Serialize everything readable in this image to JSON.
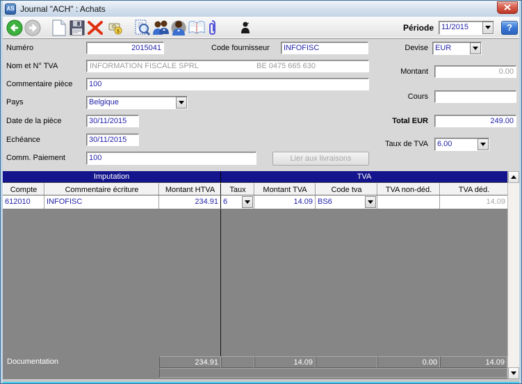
{
  "window": {
    "title": "Journal \"ACH\" : Achats",
    "app_icon_text": "AS"
  },
  "toolbar": {
    "icons": [
      "back-icon",
      "forward-icon",
      "new-document-icon",
      "save-icon",
      "delete-icon",
      "payment-icon",
      "preview-icon",
      "suppliers-icon",
      "supplier-icon",
      "book-icon",
      "attachment-icon",
      "user-icon"
    ],
    "period_label": "Période",
    "period_value": "11/2015",
    "help_label": "?"
  },
  "form": {
    "numero": {
      "label": "Numéro",
      "value": "2015041"
    },
    "code_fournisseur": {
      "label": "Code fournisseur",
      "value": "INFOFISC"
    },
    "nom_tva": {
      "label": "Nom et N° TVA",
      "name": "INFORMATION FISCALE SPRL",
      "vat": "BE 0475 665 630"
    },
    "commentaire_piece": {
      "label": "Commentaire pièce",
      "value": "100"
    },
    "pays": {
      "label": "Pays",
      "value": "Belgique"
    },
    "date_piece": {
      "label": "Date de la pièce",
      "value": "30/11/2015"
    },
    "echeance": {
      "label": "Echéance",
      "value": "30/11/2015"
    },
    "comm_paiement": {
      "label": "Comm. Paiement",
      "value": "100"
    },
    "lier_button_label": "Lier aux livraisons",
    "devise": {
      "label": "Devise",
      "value": "EUR"
    },
    "montant": {
      "label": "Montant",
      "value": "0.00"
    },
    "cours": {
      "label": "Cours",
      "value": ""
    },
    "total_eur": {
      "label": "Total EUR",
      "value": "249.00"
    },
    "taux_tva": {
      "label": "Taux de TVA",
      "value": "6.00"
    }
  },
  "table": {
    "groups": {
      "imputation": "Imputation",
      "tva": "TVA"
    },
    "columns": [
      "Compte",
      "Commentaire écriture",
      "Montant HTVA",
      "Taux",
      "Montant TVA",
      "Code tva",
      "TVA non-déd.",
      "TVA déd."
    ],
    "rows": [
      {
        "compte": "612010",
        "commentaire": "INFOFISC",
        "montant_htva": "234.91",
        "taux": "6",
        "montant_tva": "14.09",
        "code_tva": "BS6",
        "tva_non_ded": "",
        "tva_ded": "14.09"
      }
    ],
    "footer": {
      "label": "Documentation",
      "montant_htva": "234.91",
      "montant_tva": "14.09",
      "tva_non_ded": "0.00",
      "tva_ded": "14.09"
    }
  },
  "colors": {
    "accent_navy_header": "#14158c",
    "value_text_blue": "#2222aa",
    "close_red": "#bc3526",
    "frame_blue": "#bfd4e6",
    "cyan_accent": "#45cdf0",
    "gray_panel": "#868686"
  }
}
